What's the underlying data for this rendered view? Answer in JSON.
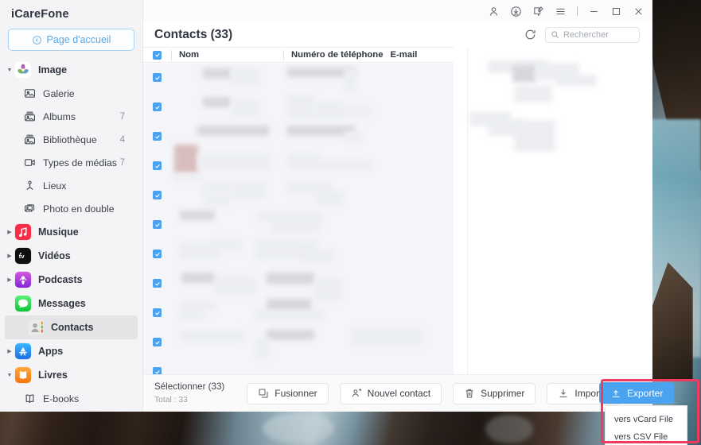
{
  "app": {
    "brand": "iCareFone",
    "home_button": "Page d'accueil",
    "accent_color": "#4ba3f0",
    "annotation_color": "#ef3c5e"
  },
  "titlebar": {
    "icons": [
      {
        "name": "account-icon",
        "glyph": "person"
      },
      {
        "name": "download-icon",
        "glyph": "download-circle"
      },
      {
        "name": "feedback-icon",
        "glyph": "message-edit"
      },
      {
        "name": "menu-icon",
        "glyph": "hamburger"
      }
    ],
    "window_controls": [
      {
        "name": "minimize-button",
        "glyph": "minimize"
      },
      {
        "name": "maximize-button",
        "glyph": "maximize"
      },
      {
        "name": "close-button",
        "glyph": "close"
      }
    ]
  },
  "sidebar": {
    "items": [
      {
        "label": "Image",
        "icon": "photos-icon",
        "count": "",
        "expanded": true,
        "level": 0,
        "has_caret": true
      },
      {
        "label": "Galerie",
        "icon": "gallery-icon",
        "count": "",
        "level": 1,
        "has_caret": false
      },
      {
        "label": "Albums",
        "icon": "albums-icon",
        "count": "7",
        "level": 1,
        "has_caret": false
      },
      {
        "label": "Bibliothèque",
        "icon": "library-icon",
        "count": "4",
        "level": 1,
        "has_caret": false
      },
      {
        "label": "Types de médias",
        "icon": "media-types-icon",
        "count": "7",
        "level": 1,
        "has_caret": false
      },
      {
        "label": "Lieux",
        "icon": "places-icon",
        "count": "",
        "level": 1,
        "has_caret": false
      },
      {
        "label": "Photo en double",
        "icon": "duplicate-photo-icon",
        "count": "",
        "level": 1,
        "has_caret": false
      },
      {
        "label": "Musique",
        "icon": "music-icon",
        "count": "",
        "expanded": false,
        "level": 0,
        "has_caret": true
      },
      {
        "label": "Vidéos",
        "icon": "appletv-icon",
        "count": "",
        "expanded": false,
        "level": 0,
        "has_caret": true
      },
      {
        "label": "Podcasts",
        "icon": "podcasts-icon",
        "count": "",
        "expanded": false,
        "level": 0,
        "has_caret": true
      },
      {
        "label": "Messages",
        "icon": "messages-icon",
        "count": "",
        "level": 0,
        "has_caret": false
      },
      {
        "label": "Contacts",
        "icon": "contacts-icon",
        "count": "",
        "level": 0,
        "has_caret": false,
        "active": true
      },
      {
        "label": "Apps",
        "icon": "appstore-icon",
        "count": "",
        "expanded": false,
        "level": 0,
        "has_caret": true
      },
      {
        "label": "Livres",
        "icon": "books-icon",
        "count": "",
        "expanded": true,
        "level": 0,
        "has_caret": true
      },
      {
        "label": "E-books",
        "icon": "ebook-icon",
        "count": "",
        "level": 1,
        "has_caret": false
      }
    ]
  },
  "main": {
    "title": "Contacts (33)",
    "refresh_icon": "refresh-icon",
    "search": {
      "placeholder": "Rechercher",
      "value": "",
      "icon": "search-icon"
    },
    "table": {
      "columns": [
        "Nom",
        "Numéro de téléphone",
        "E-mail"
      ],
      "header_checkbox_checked": true,
      "rows_visible": 11,
      "all_rows_checked": true,
      "content_redacted": true
    }
  },
  "toolbar": {
    "select_label": "Sélectionner  (33)",
    "total_label": "Total : 33",
    "buttons": [
      {
        "label": "Fusionner",
        "icon": "merge-icon"
      },
      {
        "label": "Nouvel contact",
        "icon": "person-add-icon"
      },
      {
        "label": "Supprimer",
        "icon": "trash-icon"
      },
      {
        "label": "Importer",
        "icon": "import-icon"
      },
      {
        "label": "Exporter",
        "icon": "export-icon",
        "primary": true
      }
    ]
  },
  "export_menu": {
    "items": [
      "vers vCard File",
      "vers CSV File"
    ]
  }
}
